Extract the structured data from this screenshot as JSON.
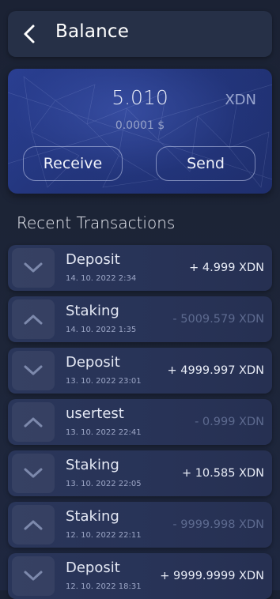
{
  "header": {
    "title": "Balance"
  },
  "balance": {
    "amount": "5.010",
    "unit": "XDN",
    "fiat": "0.0001 $",
    "receive_label": "Receive",
    "send_label": "Send"
  },
  "recent": {
    "title": "Recent Transactions",
    "items": [
      {
        "type": "Deposit",
        "date": "14. 10. 2022 2:34",
        "amount": "+ 4.999 XDN",
        "direction": "in"
      },
      {
        "type": "Staking",
        "date": "14. 10. 2022 1:35",
        "amount": "- 5009.579 XDN",
        "direction": "out"
      },
      {
        "type": "Deposit",
        "date": "13. 10. 2022 23:01",
        "amount": "+ 4999.997 XDN",
        "direction": "in"
      },
      {
        "type": "usertest",
        "date": "13. 10. 2022 22:41",
        "amount": "- 0.999 XDN",
        "direction": "out"
      },
      {
        "type": "Staking",
        "date": "13. 10. 2022 22:05",
        "amount": "+ 10.585 XDN",
        "direction": "in"
      },
      {
        "type": "Staking",
        "date": "12. 10. 2022 22:11",
        "amount": "- 9999.998 XDN",
        "direction": "out"
      },
      {
        "type": "Deposit",
        "date": "12. 10. 2022 18:31",
        "amount": "+ 9999.9999 XDN",
        "direction": "in"
      }
    ]
  },
  "colors": {
    "background": "#1b2234",
    "card": "#263047",
    "accent": "#2a3f92",
    "negative_amount": "#5d6a8f"
  },
  "icons": {
    "back": "chevron-left-icon",
    "incoming": "chevron-down-icon",
    "outgoing": "chevron-up-icon"
  }
}
